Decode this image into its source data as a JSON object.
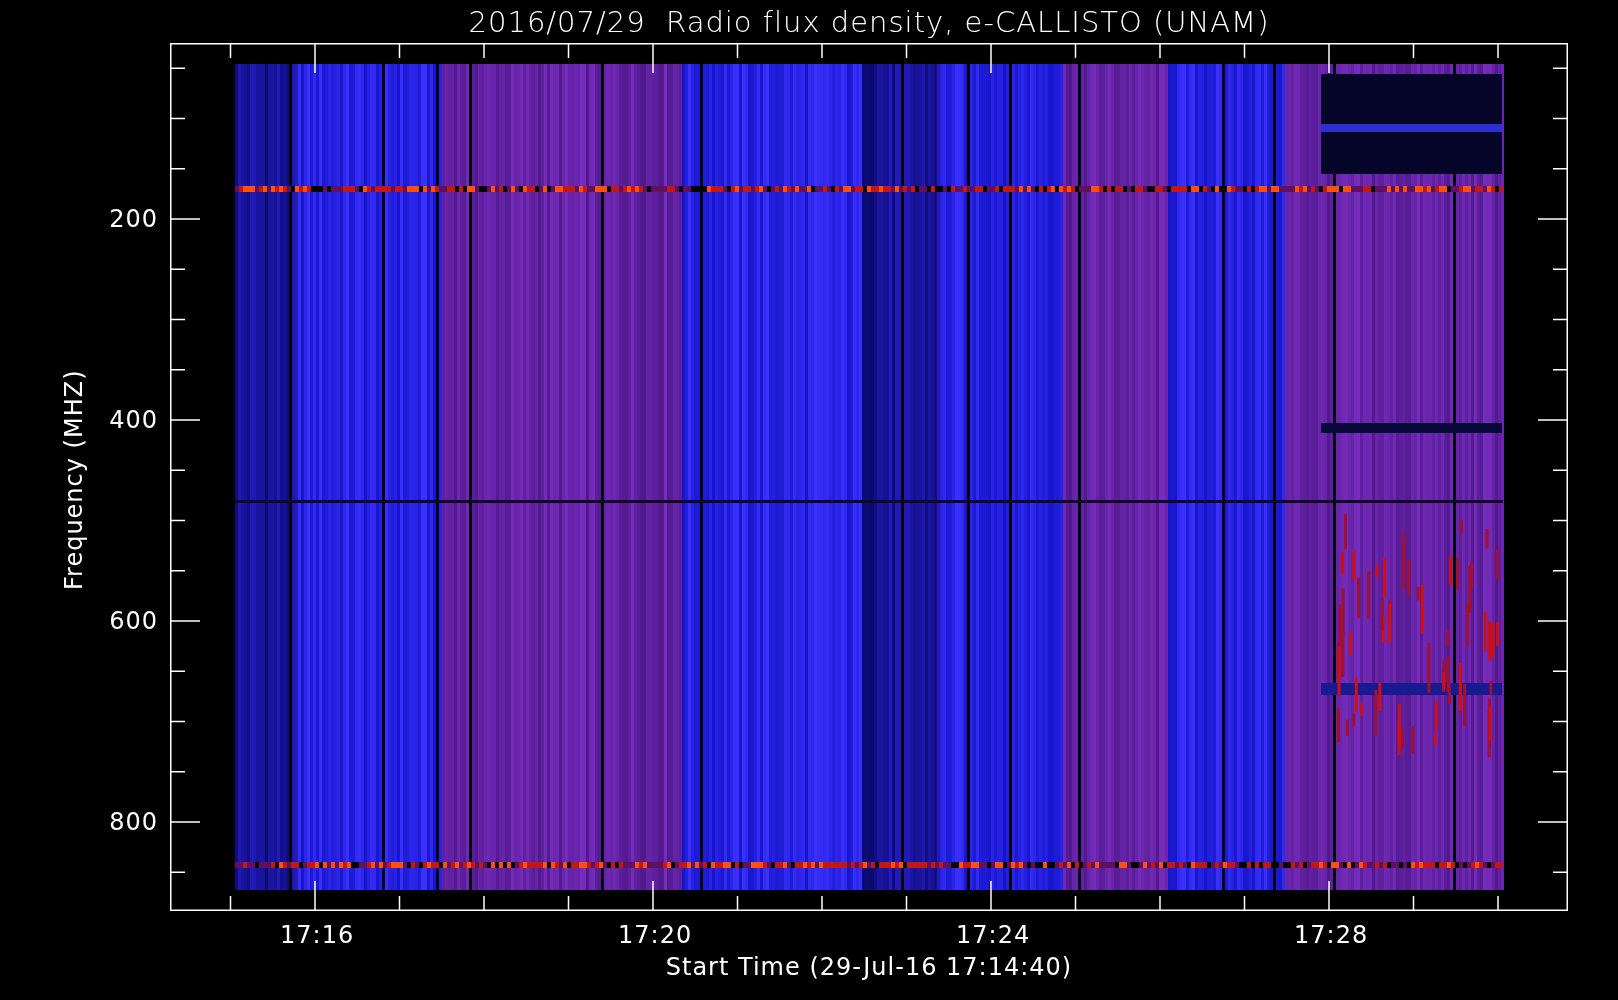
{
  "title": "2016/07/29  Radio flux density, e-CALLISTO (UNAM)",
  "y_axis": {
    "label": "Frequency (MHZ)",
    "ticks": [
      "200",
      "400",
      "600",
      "800"
    ]
  },
  "x_axis": {
    "label": "Start Time (29-Jul-16 17:14:40)",
    "ticks": [
      "17:16",
      "17:20",
      "17:24",
      "17:28"
    ]
  }
}
